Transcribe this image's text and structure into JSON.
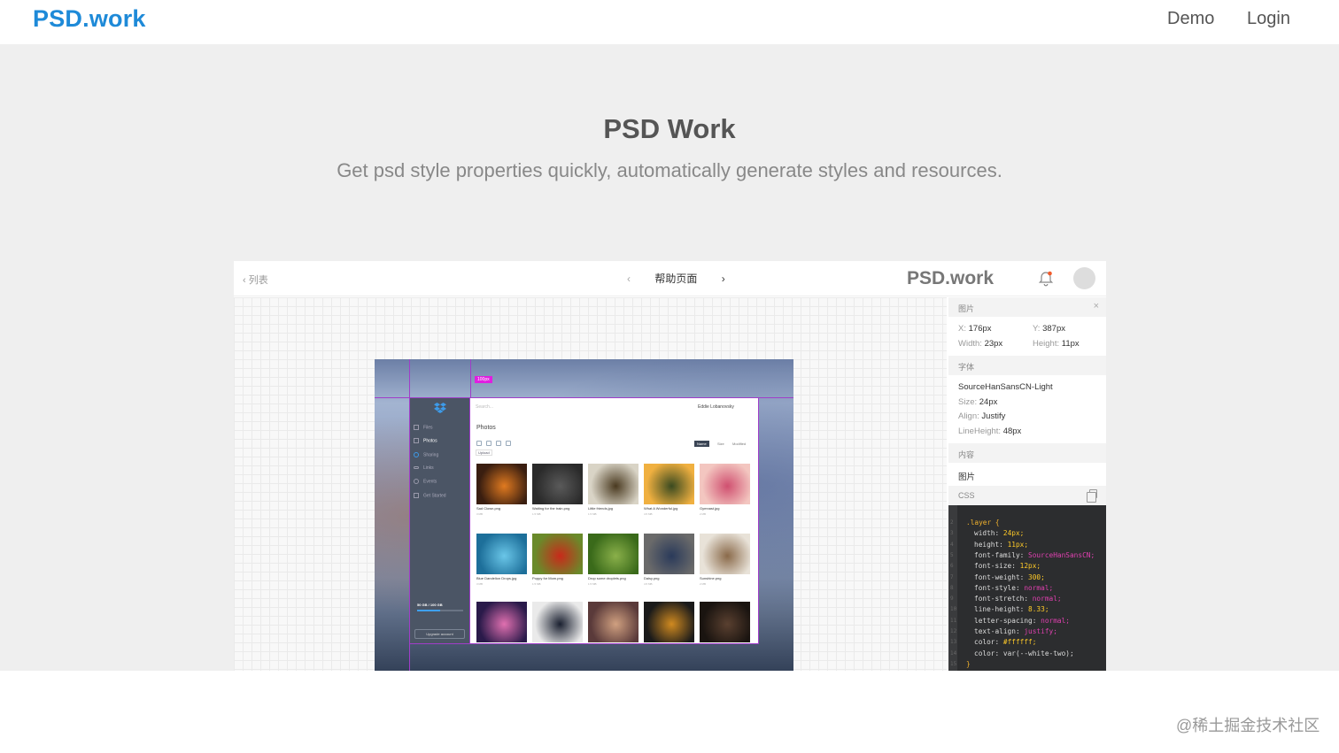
{
  "nav": {
    "logo": "PSD.work",
    "demo": "Demo",
    "login": "Login"
  },
  "hero": {
    "title": "PSD Work",
    "subtitle": "Get psd style properties quickly, automatically generate styles and resources."
  },
  "viewer": {
    "back_label": "列表",
    "page_title": "帮助页面",
    "logo": "PSD.work",
    "icons": {
      "back": "chevron-left-icon",
      "prev": "chevron-left-icon",
      "next": "chevron-right-icon",
      "bell": "bell-icon",
      "avatar": "avatar"
    }
  },
  "design": {
    "guide_badge": "100px",
    "search_placeholder": "Search...",
    "user_name": "Eddie Lobanovsky",
    "page_title": "Photos",
    "upload": "Upload",
    "sort": [
      "Name",
      "Size",
      "Modified"
    ],
    "sidebar": [
      {
        "label": "Files",
        "active": false
      },
      {
        "label": "Photos",
        "active": true
      },
      {
        "label": "Sharing",
        "active": false
      },
      {
        "label": "Links",
        "active": false
      },
      {
        "label": "Events",
        "active": false
      },
      {
        "label": "Get Started",
        "active": false
      }
    ],
    "storage": "50 GB / 100 GB",
    "storage_fraction": 0.5,
    "upgrade": "Upgrade account",
    "photos": [
      {
        "name": "Sad Clown.png",
        "size": "3 MB",
        "colors": [
          "#3a1e10",
          "#e07a20"
        ]
      },
      {
        "name": "Waiting for the train.png",
        "size": "1.5 MB",
        "colors": [
          "#2a2a2a",
          "#5a5a5a"
        ]
      },
      {
        "name": "Little friends.jpg",
        "size": "1.5 MB",
        "colors": [
          "#d9d4c6",
          "#4a3a20"
        ]
      },
      {
        "name": "What A Wonderful.jpg",
        "size": "4.5 MB",
        "colors": [
          "#f0b040",
          "#3a4a20"
        ]
      },
      {
        "name": "Gymnast.jpg",
        "size": "2 MB",
        "colors": [
          "#f3c6c0",
          "#d05070"
        ]
      },
      {
        "name": "Blue Dandelion Drops.jpg",
        "size": "3 MB",
        "colors": [
          "#1d6f9a",
          "#6ac6e8"
        ]
      },
      {
        "name": "Poppy for Mom.png",
        "size": "1.5 MB",
        "colors": [
          "#6a8a2a",
          "#c82a1a"
        ]
      },
      {
        "name": "Drop some droplets.png",
        "size": "1.5 MB",
        "colors": [
          "#3a6a1a",
          "#8ab04a"
        ]
      },
      {
        "name": "Daisy.png",
        "size": "4.5 MB",
        "colors": [
          "#6a6a6a",
          "#2a3a5a"
        ]
      },
      {
        "name": "Sunshine.png",
        "size": "2 MB",
        "colors": [
          "#e8e2d8",
          "#8a6a4a"
        ]
      },
      {
        "name": "",
        "size": "",
        "colors": [
          "#2a1a4a",
          "#e070b0"
        ]
      },
      {
        "name": "",
        "size": "",
        "colors": [
          "#eaeaea",
          "#1a2030"
        ]
      },
      {
        "name": "",
        "size": "",
        "colors": [
          "#5a3a3a",
          "#d0a080"
        ]
      },
      {
        "name": "",
        "size": "",
        "colors": [
          "#1a1a1a",
          "#d08a20"
        ]
      },
      {
        "name": "",
        "size": "",
        "colors": [
          "#1a1410",
          "#5a4030"
        ]
      }
    ]
  },
  "panel": {
    "sec_image": "图片",
    "x_label": "X:",
    "x_value": "176px",
    "y_label": "Y:",
    "y_value": "387px",
    "w_label": "Width:",
    "w_value": "23px",
    "h_label": "Height:",
    "h_value": "11px",
    "sec_font": "字体",
    "font_family": "SourceHanSansCN-Light",
    "size_label": "Size:",
    "size_value": "24px",
    "align_label": "Align:",
    "align_value": "Justify",
    "lh_label": "LineHeight:",
    "lh_value": "48px",
    "sec_content": "内容",
    "content_value": "图片",
    "sec_css": "CSS",
    "code": [
      {
        "p": "",
        "v": "",
        "t": "sel",
        "s": ".layer {"
      },
      {
        "p": "width:",
        "v": "24px;",
        "t": "n"
      },
      {
        "p": "height:",
        "v": "11px;",
        "t": "n"
      },
      {
        "p": "font-family:",
        "v": "SourceHanSansCN;",
        "t": "s"
      },
      {
        "p": "font-size:",
        "v": "12px;",
        "t": "n"
      },
      {
        "p": "font-weight:",
        "v": "300;",
        "t": "n"
      },
      {
        "p": "font-style:",
        "v": "normal;",
        "t": "s"
      },
      {
        "p": "font-stretch:",
        "v": "normal;",
        "t": "s"
      },
      {
        "p": "line-height:",
        "v": "8.33;",
        "t": "n"
      },
      {
        "p": "letter-spacing:",
        "v": "normal;",
        "t": "s"
      },
      {
        "p": "text-align:",
        "v": "justify;",
        "t": "s"
      },
      {
        "p": "color:",
        "v": "#ffffff;",
        "t": "n"
      },
      {
        "p": "color:",
        "v": "var(--white-two);",
        "t": "f"
      },
      {
        "p": "",
        "v": "",
        "t": "sel",
        "s": "}"
      }
    ]
  },
  "watermark": "@稀土掘金技术社区"
}
